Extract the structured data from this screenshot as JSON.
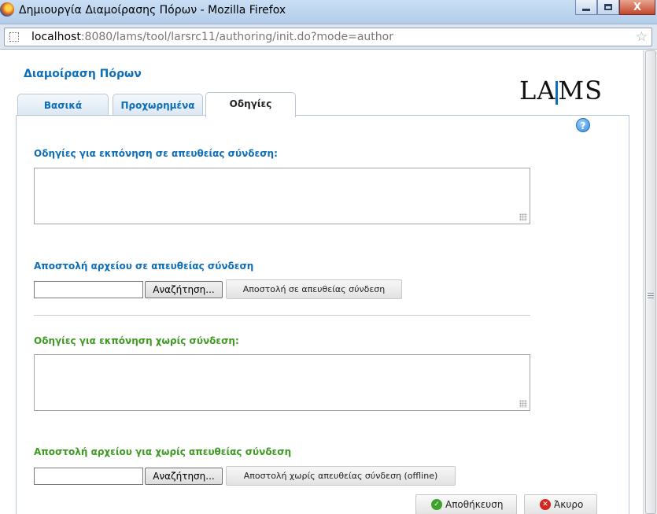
{
  "window": {
    "title": "Δημιουργία Διαμοίρασης Πόρων - Mozilla Firefox",
    "controls": {
      "minimize": "",
      "maximize": "",
      "close": "X"
    }
  },
  "address_bar": {
    "host": "localhost",
    "path": ":8080/lams/tool/larsrc11/authoring/init.do?mode=author"
  },
  "page": {
    "heading": "Διαμοίραση Πόρων",
    "logo": {
      "text_left": "LA",
      "text_right": "MS",
      "color": "#0e6fb8"
    },
    "tabs": [
      {
        "label": "Βασικά",
        "active": false
      },
      {
        "label": "Προχωρημένα",
        "active": false
      },
      {
        "label": "Οδηγίες",
        "active": true
      }
    ],
    "help_icon": "?",
    "online_instructions_label": "Οδηγίες για εκπόνηση σε απευθείας σύνδεση:",
    "online_instructions_value": "",
    "online_upload_label": "Αποστολή αρχείου σε απευθείας σύνδεση",
    "online_browse_label": "Αναζήτηση...",
    "online_upload_button": "Αποστολή σε απευθείας σύνδεση",
    "offline_instructions_label": "Οδηγίες για εκπόνηση χωρίς σύνδεση:",
    "offline_instructions_value": "",
    "offline_upload_label": "Αποστολή αρχείου για χωρίς απευθείας σύνδεση",
    "offline_browse_label": "Αναζήτηση...",
    "offline_upload_button": "Αποστολή χωρίς απευθείας σύνδεση (offline)",
    "save_button": "Αποθήκευση",
    "cancel_button": "Άκυρο"
  },
  "colors": {
    "accent_blue": "#0e6fb8",
    "accent_green": "#3e9b22"
  }
}
